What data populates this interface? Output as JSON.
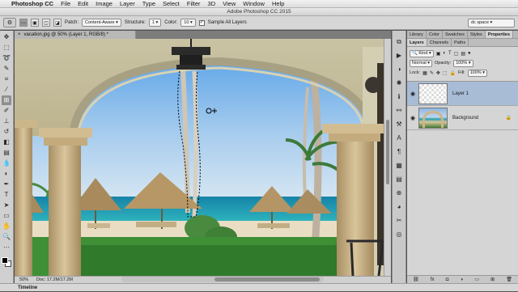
{
  "menubar": {
    "apple": "",
    "app_name": "Photoshop CC",
    "items": [
      "File",
      "Edit",
      "Image",
      "Layer",
      "Type",
      "Select",
      "Filter",
      "3D",
      "View",
      "Window",
      "Help"
    ]
  },
  "window": {
    "title": "Adobe Photoshop CC 2015"
  },
  "options": {
    "patch_label": "Patch:",
    "patch_value": "Content-Aware",
    "structure_label": "Structure:",
    "structure_value": "1",
    "color_label": "Color:",
    "color_value": "10",
    "sample_all_label": "Sample All Layers",
    "sample_all_checked": "✓",
    "workspace": "dc space"
  },
  "document": {
    "tab_title": "vacation.jpg @ 50% (Layer 1, RGB/8) *",
    "close": "×"
  },
  "status": {
    "zoom": "50%",
    "doc_size": "Doc: 17.2M/17.2M"
  },
  "timeline": {
    "label": "Timeline"
  },
  "panels": {
    "top_tabs": [
      "Library",
      "Color",
      "Swatches",
      "Styles",
      "Properties"
    ],
    "layer_tabs": [
      "Layers",
      "Channels",
      "Paths"
    ],
    "kind": "Kind",
    "blend_mode": "Normal",
    "opacity_label": "Opacity:",
    "opacity_value": "100%",
    "lock_label": "Lock:",
    "fill_label": "Fill:",
    "fill_value": "100%",
    "layers": [
      {
        "name": "Layer 1"
      },
      {
        "name": "Background"
      }
    ],
    "footer_icons": [
      "link",
      "fx",
      "mask",
      "adjust",
      "folder",
      "new",
      "trash"
    ]
  },
  "colors": {
    "sky_top": "#5ea6e6",
    "sea": "#1f9fb3",
    "stone": "#cdb387",
    "selection_blue": "#a9bcd6"
  }
}
